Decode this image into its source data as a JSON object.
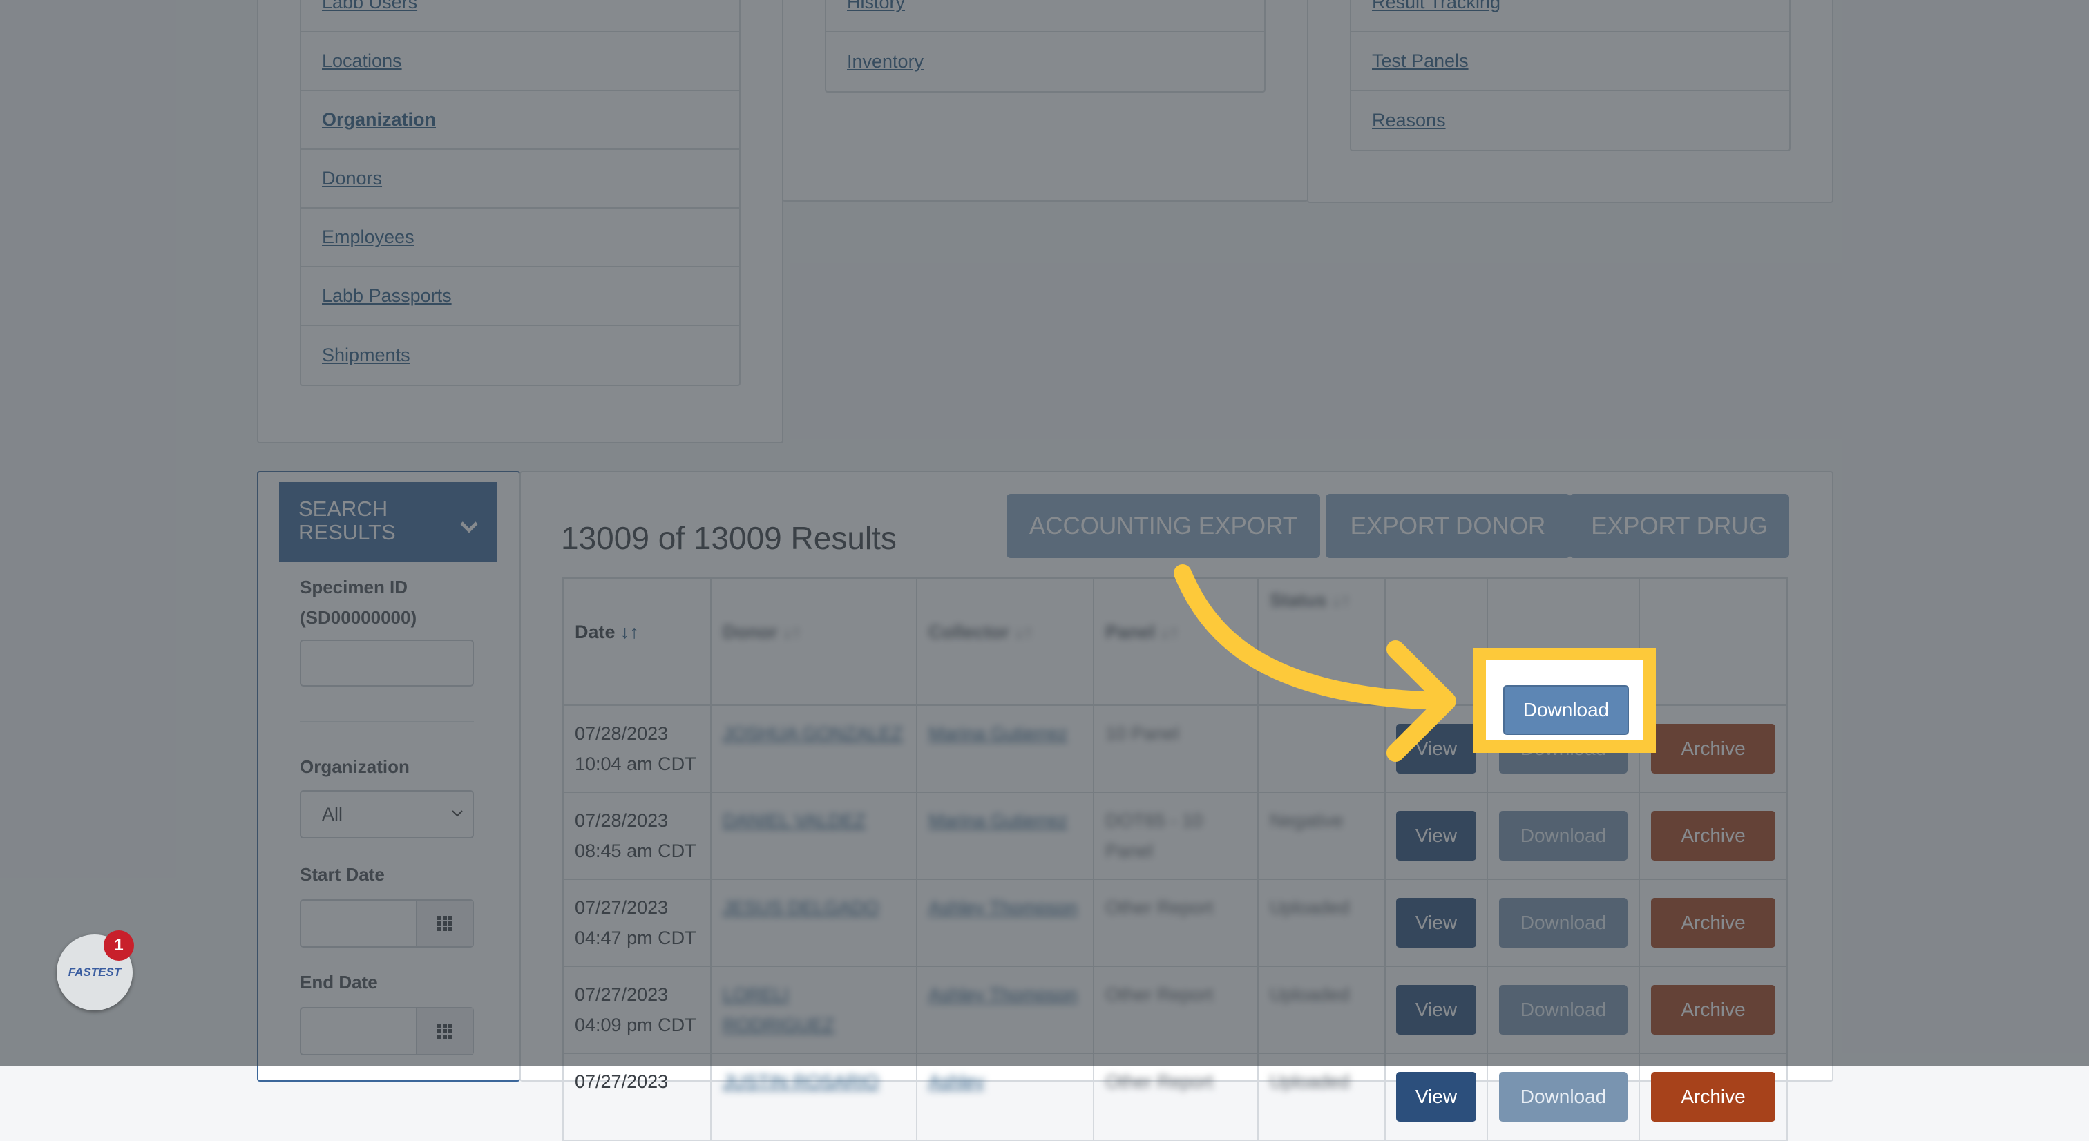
{
  "nav": {
    "col1": [
      {
        "label": "Labb Users",
        "bold": false
      },
      {
        "label": "Locations",
        "bold": false
      },
      {
        "label": "Organization",
        "bold": true
      },
      {
        "label": "Donors",
        "bold": false
      },
      {
        "label": "Employees",
        "bold": false
      },
      {
        "label": "Labb Passports",
        "bold": false
      },
      {
        "label": "Shipments",
        "bold": false
      }
    ],
    "col2": [
      {
        "label": "History"
      },
      {
        "label": "Inventory"
      }
    ],
    "col3": [
      {
        "label": "Result Tracking"
      },
      {
        "label": "Test Panels"
      },
      {
        "label": "Reasons"
      }
    ]
  },
  "search": {
    "header": "SEARCH RESULTS",
    "specimen_label": "Specimen ID (SD00000000)",
    "organization_label": "Organization",
    "organization_value": "All",
    "start_date_label": "Start Date",
    "end_date_label": "End Date"
  },
  "results": {
    "title": "13009 of 13009 Results",
    "export_accounting": "ACCOUNTING EXPORT",
    "export_donor": "EXPORT DONOR",
    "export_drug": "EXPORT DRUG",
    "columns": [
      "Date",
      "Donor",
      "Collector",
      "Panel",
      "Status"
    ],
    "rows": [
      {
        "date": "07/28/2023 10:04 am CDT",
        "donor": "JOSHUA GONZALEZ",
        "collector": "Marina Gutierrez",
        "panel": "10 Panel",
        "status": ""
      },
      {
        "date": "07/28/2023 08:45 am CDT",
        "donor": "DANIEL VALDEZ",
        "collector": "Marina Gutierrez",
        "panel": "DOT65 - 10 Panel",
        "status": "Negative"
      },
      {
        "date": "07/27/2023 04:47 pm CDT",
        "donor": "JESUS DELGADO",
        "collector": "Ashley Thompson",
        "panel": "Other Report",
        "status": "Uploaded"
      },
      {
        "date": "07/27/2023 04:09 pm CDT",
        "donor": "LORELI RODRIGUEZ",
        "collector": "Ashley Thompson",
        "panel": "Other Report",
        "status": "Uploaded"
      },
      {
        "date": "07/27/2023",
        "donor": "JUSTIN ROSARIO",
        "collector": "Ashley",
        "panel": "Other Report",
        "status": "Uploaded"
      }
    ],
    "view_label": "View",
    "download_label": "Download",
    "archive_label": "Archive"
  },
  "badge": {
    "logo": "FASTEST",
    "count": "1"
  },
  "colors": {
    "highlight": "#fdc93a",
    "primary": "#3c679a",
    "archive": "#a7421b"
  }
}
